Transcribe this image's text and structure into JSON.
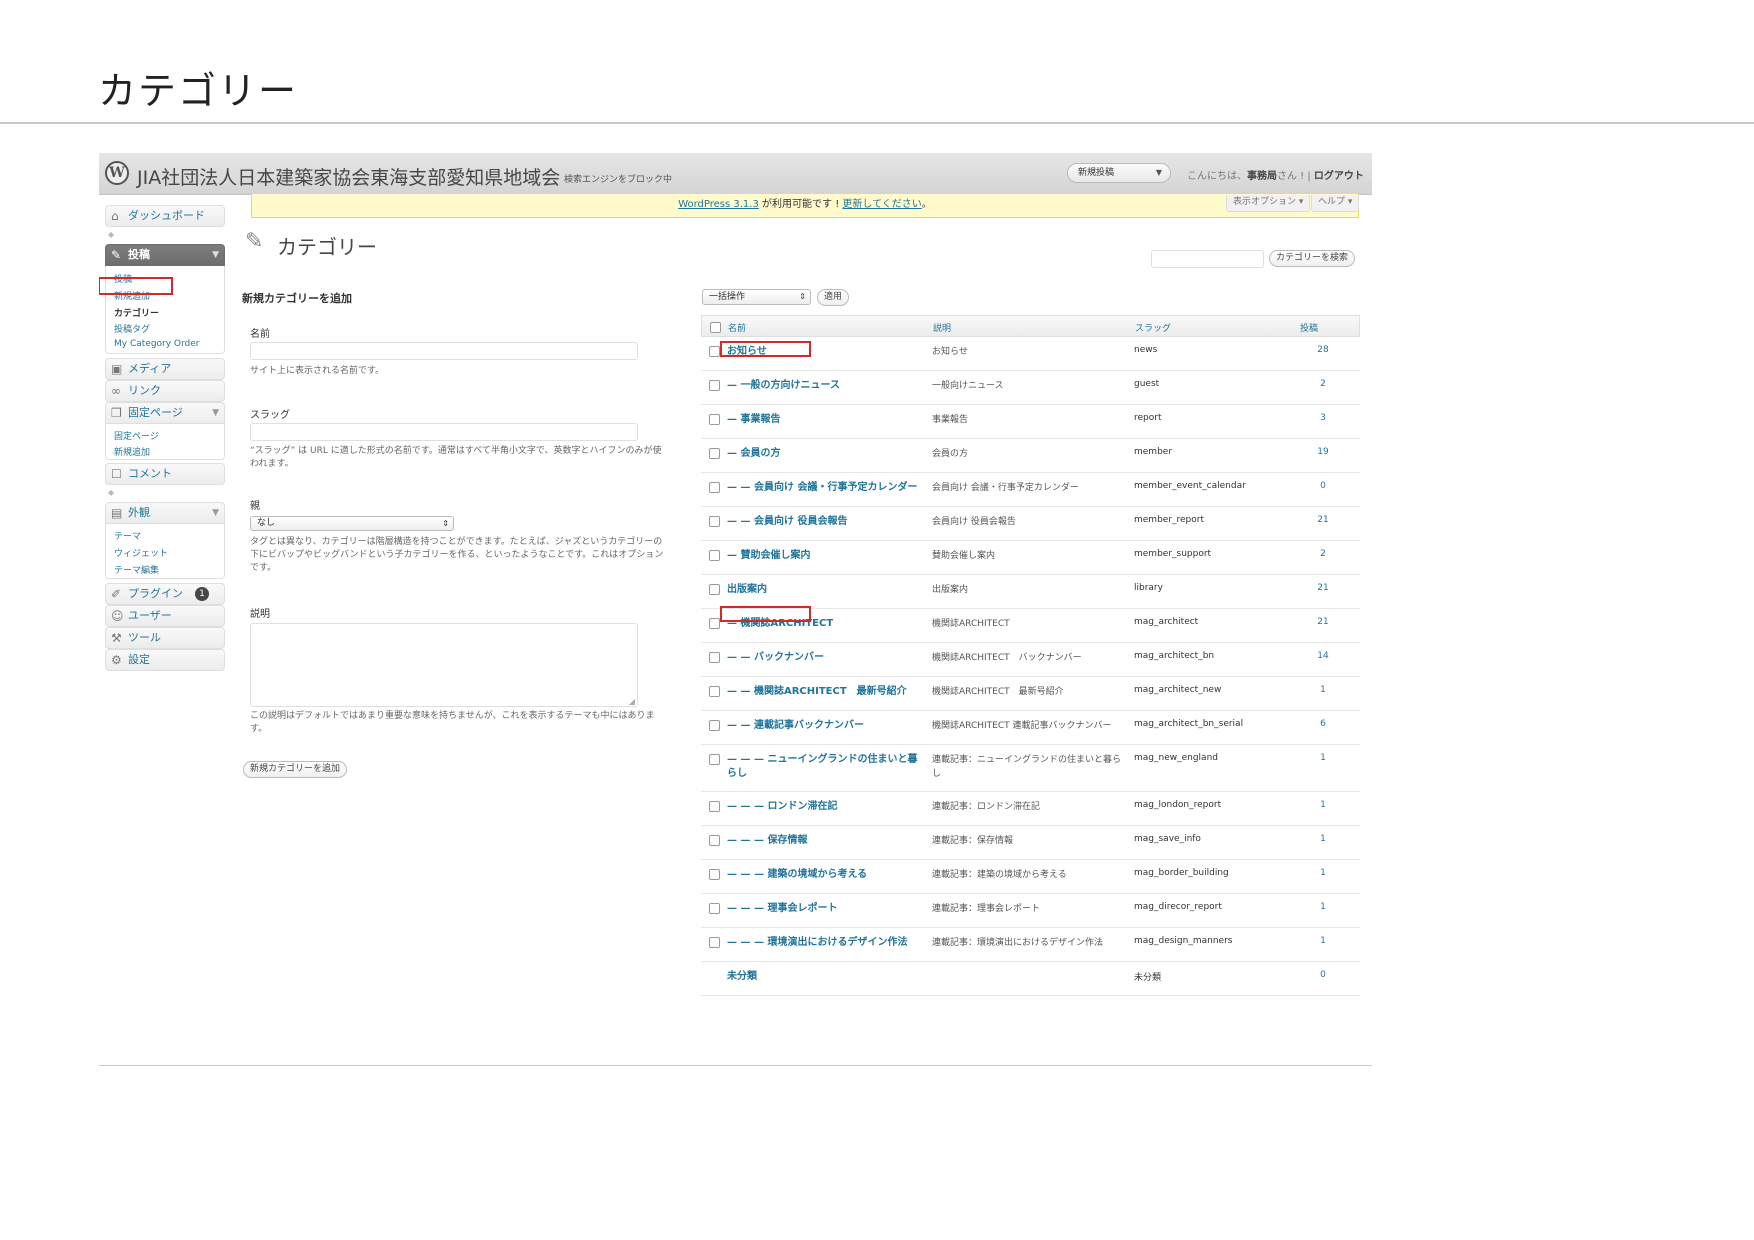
{
  "document": {
    "title": "カテゴリー"
  },
  "header": {
    "site_title": "JIA社団法人日本建築家協会東海支部愛知県地域会",
    "site_note": "検索エンジンをブロック中",
    "new_post_label": "新規投稿",
    "greeting_prefix": "こんにちは、",
    "user": "事務局",
    "greeting_suffix": "さん !",
    "logout": "ログアウト"
  },
  "notice": {
    "link_version": "WordPress 3.1.3",
    "text_mid": " が利用可能です ! ",
    "link_update": "更新してください",
    "text_end": "。"
  },
  "screen_options": "表示オプション ▾",
  "help": "ヘルプ ▾",
  "sidebar": {
    "dashboard": "ダッシュボード",
    "posts": "投稿",
    "posts_sub": [
      "投稿",
      "新規追加",
      "カテゴリー",
      "投稿タグ",
      "My Category Order"
    ],
    "media": "メディア",
    "links": "リンク",
    "pages": "固定ページ",
    "pages_sub": [
      "固定ページ",
      "新規追加"
    ],
    "comments": "コメント",
    "appearance": "外観",
    "appearance_sub": [
      "テーマ",
      "ウィジェット",
      "テーマ編集"
    ],
    "plugins": "プラグイン",
    "plugins_badge": "1",
    "users": "ユーザー",
    "tools": "ツール",
    "settings": "設定"
  },
  "page": {
    "title": "カテゴリー",
    "search_button": "カテゴリーを検索"
  },
  "form": {
    "heading": "新規カテゴリーを追加",
    "name_label": "名前",
    "name_help": "サイト上に表示される名前です。",
    "slug_label": "スラッグ",
    "slug_help": "“スラッグ” は URL に適した形式の名前です。通常はすべて半角小文字で、英数字とハイフンのみが使われます。",
    "parent_label": "親",
    "parent_value": "なし",
    "parent_help": "タグとは異なり、カテゴリーは階層構造を持つことができます。たとえば、ジャズというカテゴリーの下にビバップやビッグバンドという子カテゴリーを作る、といったようなことです。これはオプションです。",
    "desc_label": "説明",
    "desc_help": "この説明はデフォルトではあまり重要な意味を持ちませんが、これを表示するテーマも中にはあります。",
    "submit": "新規カテゴリーを追加"
  },
  "bulk": {
    "value": "一括操作",
    "apply": "適用"
  },
  "table": {
    "headers": {
      "name": "名前",
      "desc": "説明",
      "slug": "スラッグ",
      "count": "投稿"
    },
    "rows": [
      {
        "name": "お知らせ",
        "desc": "お知らせ",
        "slug": "news",
        "count": "28"
      },
      {
        "name": "— 一般の方向けニュース",
        "desc": "一般向けニュース",
        "slug": "guest",
        "count": "2"
      },
      {
        "name": "— 事業報告",
        "desc": "事業報告",
        "slug": "report",
        "count": "3"
      },
      {
        "name": "— 会員の方",
        "desc": "会員の方",
        "slug": "member",
        "count": "19"
      },
      {
        "name": "— — 会員向け 会議・行事予定カレンダー",
        "desc": "会員向け 会議・行事予定カレンダー",
        "slug": "member_event_calendar",
        "count": "0"
      },
      {
        "name": "— — 会員向け 役員会報告",
        "desc": "会員向け 役員会報告",
        "slug": "member_report",
        "count": "21"
      },
      {
        "name": "— 賛助会催し案内",
        "desc": "賛助会催し案内",
        "slug": "member_support",
        "count": "2"
      },
      {
        "name": "出版案内",
        "desc": "出版案内",
        "slug": "library",
        "count": "21"
      },
      {
        "name": "— 機関誌ARCHITECT",
        "desc": "機関誌ARCHITECT",
        "slug": "mag_architect",
        "count": "21"
      },
      {
        "name": "— — バックナンバー",
        "desc": "機関誌ARCHITECT　バックナンバー",
        "slug": "mag_architect_bn",
        "count": "14"
      },
      {
        "name": "— — 機関誌ARCHITECT　最新号紹介",
        "desc": "機関誌ARCHITECT　最新号紹介",
        "slug": "mag_architect_new",
        "count": "1"
      },
      {
        "name": "— — 連載記事バックナンバー",
        "desc": "機関誌ARCHITECT 連載記事バックナンバー",
        "slug": "mag_architect_bn_serial",
        "count": "6"
      },
      {
        "name": "— — — ニューイングランドの住まいと暮らし",
        "desc": "連載記事：ニューイングランドの住まいと暮らし",
        "slug": "mag_new_england",
        "count": "1"
      },
      {
        "name": "— — — ロンドン滞在記",
        "desc": "連載記事：ロンドン滞在記",
        "slug": "mag_london_report",
        "count": "1"
      },
      {
        "name": "— — — 保存情報",
        "desc": "連載記事：保存情報",
        "slug": "mag_save_info",
        "count": "1"
      },
      {
        "name": "— — — 建築の境域から考える",
        "desc": "連載記事：建築の境域から考える",
        "slug": "mag_border_building",
        "count": "1"
      },
      {
        "name": "— — — 理事会レポート",
        "desc": "連載記事：理事会レポート",
        "slug": "mag_direcor_report",
        "count": "1"
      },
      {
        "name": "— — — 環境演出におけるデザイン作法",
        "desc": "連載記事：環境演出におけるデザイン作法",
        "slug": "mag_design_manners",
        "count": "1"
      },
      {
        "name": "未分類",
        "desc": "",
        "slug": "未分類",
        "count": "0"
      }
    ]
  },
  "icons": {
    "wp_logo": "wordpress-logo-icon",
    "page_icon": "pushpin-icon"
  }
}
